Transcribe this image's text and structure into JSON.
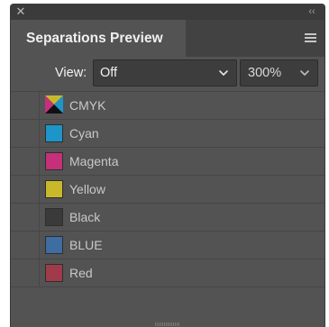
{
  "panel": {
    "close_glyph": "✕",
    "collapse_glyph": "‹‹",
    "title": "Separations Preview",
    "menu_icon": "hamburger-menu-icon"
  },
  "view_control": {
    "label": "View:",
    "selected": "Off",
    "zoom": "300%"
  },
  "separations": [
    {
      "name": "CMYK",
      "color": "composite"
    },
    {
      "name": "Cyan",
      "color": "#1e95c8"
    },
    {
      "name": "Magenta",
      "color": "#c4307a"
    },
    {
      "name": "Yellow",
      "color": "#c9b92a"
    },
    {
      "name": "Black",
      "color": "#3a3a3a"
    },
    {
      "name": "BLUE",
      "color": "#3d6da1"
    },
    {
      "name": "Red",
      "color": "#a13a4a"
    }
  ]
}
